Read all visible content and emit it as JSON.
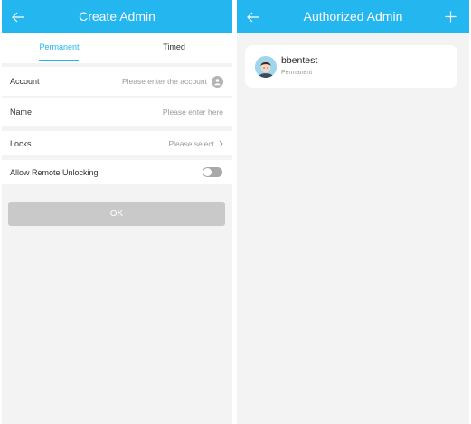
{
  "colors": {
    "accent": "#24b6ef",
    "background": "#f3f3f3",
    "button_disabled": "#c9c9c9",
    "toggle_off": "#a9a9a9"
  },
  "create_admin": {
    "header": {
      "title": "Create Admin",
      "back_icon": "arrow-left-icon"
    },
    "tabs": [
      {
        "label": "Permanent",
        "active": true
      },
      {
        "label": "Timed",
        "active": false
      }
    ],
    "account": {
      "label": "Account",
      "placeholder": "Please enter the account",
      "icon": "contact-icon"
    },
    "name": {
      "label": "Name",
      "placeholder": "Please enter here"
    },
    "locks": {
      "label": "Locks",
      "value": "Please select",
      "icon": "chevron-right-icon"
    },
    "remote_unlock": {
      "label": "Allow Remote Unlocking",
      "enabled": false
    },
    "ok_label": "OK"
  },
  "authorized_admin": {
    "header": {
      "title": "Authorized Admin",
      "back_icon": "arrow-left-icon",
      "add_icon": "plus-icon"
    },
    "admins": [
      {
        "name": "bbentest",
        "type": "Permanent",
        "avatar": "person-avatar-icon"
      }
    ]
  }
}
